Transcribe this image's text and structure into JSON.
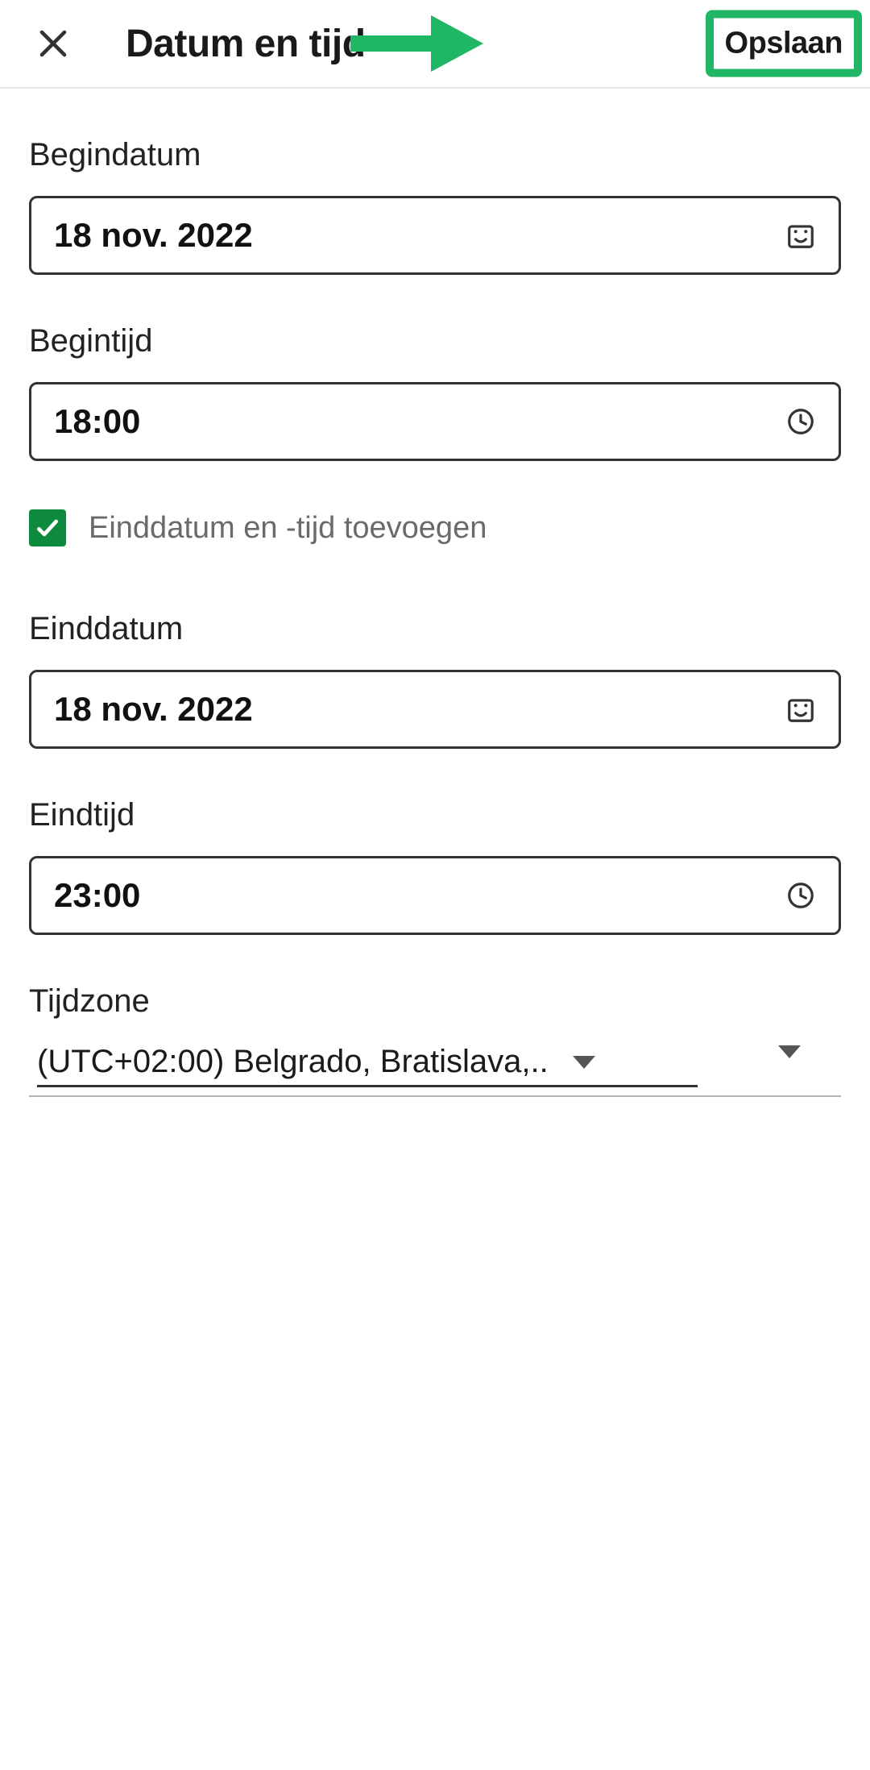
{
  "colors": {
    "accent": "#1fb765",
    "checkbox": "#0e8a3c"
  },
  "header": {
    "title": "Datum en tijd",
    "save_label": "Opslaan"
  },
  "form": {
    "begindatum_label": "Begindatum",
    "begindatum_value": "18 nov. 2022",
    "begintijd_label": "Begintijd",
    "begintijd_value": "18:00",
    "add_end_label": "Einddatum en -tijd toevoegen",
    "add_end_checked": true,
    "einddatum_label": "Einddatum",
    "einddatum_value": "18 nov. 2022",
    "eindtijd_label": "Eindtijd",
    "eindtijd_value": "23:00",
    "timezone_label": "Tijdzone",
    "timezone_value": "(UTC+02:00) Belgrado, Bratislava,.."
  }
}
